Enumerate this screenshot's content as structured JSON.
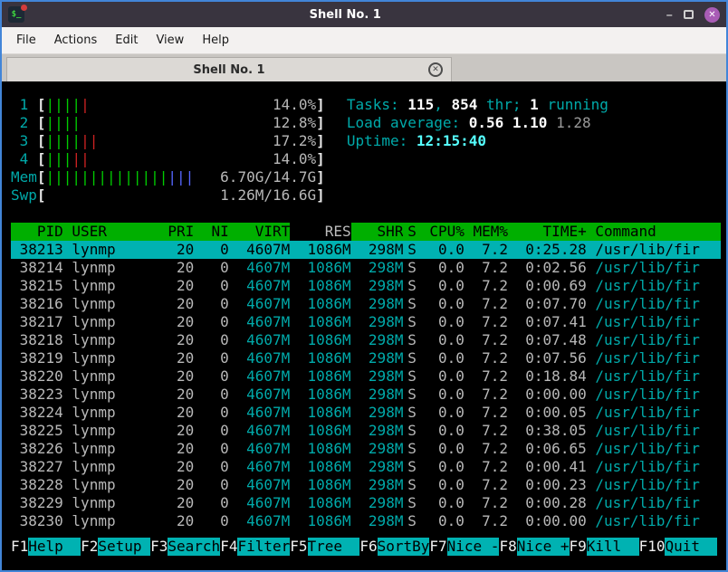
{
  "window": {
    "title": "Shell No. 1",
    "icon_glyph": "$_",
    "controls": {
      "minimize": "–",
      "close": "✕"
    }
  },
  "menubar": {
    "items": [
      "File",
      "Actions",
      "Edit",
      "View",
      "Help"
    ]
  },
  "tabbar": {
    "active_tab": "Shell No. 1",
    "close_glyph": "✕"
  },
  "colors": {
    "window_border": "#4285d8",
    "header_green": "#00af00",
    "selection_cyan": "#00b2b2",
    "accent_cyan": "#00aaaa",
    "bright_cyan": "#55ffff",
    "bar_green": "#00cc00",
    "bar_red": "#cc2222",
    "bar_blue": "#5566ff",
    "terminal_bg": "#000000",
    "terminal_fg": "#b8b8b8"
  },
  "htop": {
    "meters": [
      {
        "id": "cpu1",
        "kind": "cpu",
        "label": "1",
        "segments": [
          {
            "color": "green",
            "bars": 4
          },
          {
            "color": "red",
            "bars": 1
          }
        ],
        "value": "14.0%"
      },
      {
        "id": "cpu2",
        "kind": "cpu",
        "label": "2",
        "segments": [
          {
            "color": "green",
            "bars": 4
          }
        ],
        "value": "12.8%"
      },
      {
        "id": "cpu3",
        "kind": "cpu",
        "label": "3",
        "segments": [
          {
            "color": "green",
            "bars": 4
          },
          {
            "color": "red",
            "bars": 2
          }
        ],
        "value": "17.2%"
      },
      {
        "id": "cpu4",
        "kind": "cpu",
        "label": "4",
        "segments": [
          {
            "color": "green",
            "bars": 3
          },
          {
            "color": "red",
            "bars": 2
          }
        ],
        "value": "14.0%"
      },
      {
        "id": "mem",
        "kind": "mem",
        "label": "Mem",
        "segments": [
          {
            "color": "green",
            "bars": 14
          },
          {
            "color": "blue",
            "bars": 3
          }
        ],
        "value": "6.70G/14.7G"
      },
      {
        "id": "swp",
        "kind": "swp",
        "label": "Swp",
        "segments": [],
        "value": "1.26M/16.6G"
      }
    ],
    "sysinfo": [
      {
        "name": "tasks-line",
        "segments": [
          {
            "t": "Tasks: ",
            "c": "lbl"
          },
          {
            "t": "115",
            "c": "val"
          },
          {
            "t": ", ",
            "c": "lbl"
          },
          {
            "t": "854",
            "c": "val"
          },
          {
            "t": " thr; ",
            "c": "lbl"
          },
          {
            "t": "1",
            "c": "val"
          },
          {
            "t": " running",
            "c": "lbl"
          }
        ]
      },
      {
        "name": "load-average-line",
        "segments": [
          {
            "t": "Load average: ",
            "c": "lbl"
          },
          {
            "t": "0.56",
            "c": "val"
          },
          {
            "t": " ",
            "c": "lbl"
          },
          {
            "t": "1.10",
            "c": "val"
          },
          {
            "t": " ",
            "c": "lbl"
          },
          {
            "t": "1.28",
            "c": "dim"
          }
        ]
      },
      {
        "name": "uptime-line",
        "segments": [
          {
            "t": "Uptime: ",
            "c": "lbl"
          },
          {
            "t": "12:15:40",
            "c": "up"
          }
        ]
      }
    ],
    "table": {
      "columns": [
        {
          "key": "pid",
          "label": "PID"
        },
        {
          "key": "user",
          "label": "USER"
        },
        {
          "key": "pri",
          "label": "PRI"
        },
        {
          "key": "ni",
          "label": "NI"
        },
        {
          "key": "virt",
          "label": "VIRT"
        },
        {
          "key": "res",
          "label": "RES"
        },
        {
          "key": "shr",
          "label": "SHR"
        },
        {
          "key": "s",
          "label": "S"
        },
        {
          "key": "cpu",
          "label": "CPU%"
        },
        {
          "key": "mem",
          "label": "MEM%"
        },
        {
          "key": "time",
          "label": "TIME+"
        },
        {
          "key": "cmd",
          "label": "Command"
        }
      ],
      "sort_key": "res",
      "selected_pid": 38213,
      "rows": [
        {
          "pid": 38213,
          "user": "lynmp",
          "pri": "20",
          "ni": "0",
          "virt": "4607M",
          "res": "1086M",
          "shr": "298M",
          "s": "S",
          "cpu": "0.0",
          "mem": "7.2",
          "time": "0:25.28",
          "cmd": "/usr/lib/fir"
        },
        {
          "pid": 38214,
          "user": "lynmp",
          "pri": "20",
          "ni": "0",
          "virt": "4607M",
          "res": "1086M",
          "shr": "298M",
          "s": "S",
          "cpu": "0.0",
          "mem": "7.2",
          "time": "0:02.56",
          "cmd": "/usr/lib/fir"
        },
        {
          "pid": 38215,
          "user": "lynmp",
          "pri": "20",
          "ni": "0",
          "virt": "4607M",
          "res": "1086M",
          "shr": "298M",
          "s": "S",
          "cpu": "0.0",
          "mem": "7.2",
          "time": "0:00.69",
          "cmd": "/usr/lib/fir"
        },
        {
          "pid": 38216,
          "user": "lynmp",
          "pri": "20",
          "ni": "0",
          "virt": "4607M",
          "res": "1086M",
          "shr": "298M",
          "s": "S",
          "cpu": "0.0",
          "mem": "7.2",
          "time": "0:07.70",
          "cmd": "/usr/lib/fir"
        },
        {
          "pid": 38217,
          "user": "lynmp",
          "pri": "20",
          "ni": "0",
          "virt": "4607M",
          "res": "1086M",
          "shr": "298M",
          "s": "S",
          "cpu": "0.0",
          "mem": "7.2",
          "time": "0:07.41",
          "cmd": "/usr/lib/fir"
        },
        {
          "pid": 38218,
          "user": "lynmp",
          "pri": "20",
          "ni": "0",
          "virt": "4607M",
          "res": "1086M",
          "shr": "298M",
          "s": "S",
          "cpu": "0.0",
          "mem": "7.2",
          "time": "0:07.48",
          "cmd": "/usr/lib/fir"
        },
        {
          "pid": 38219,
          "user": "lynmp",
          "pri": "20",
          "ni": "0",
          "virt": "4607M",
          "res": "1086M",
          "shr": "298M",
          "s": "S",
          "cpu": "0.0",
          "mem": "7.2",
          "time": "0:07.56",
          "cmd": "/usr/lib/fir"
        },
        {
          "pid": 38220,
          "user": "lynmp",
          "pri": "20",
          "ni": "0",
          "virt": "4607M",
          "res": "1086M",
          "shr": "298M",
          "s": "S",
          "cpu": "0.0",
          "mem": "7.2",
          "time": "0:18.84",
          "cmd": "/usr/lib/fir"
        },
        {
          "pid": 38223,
          "user": "lynmp",
          "pri": "20",
          "ni": "0",
          "virt": "4607M",
          "res": "1086M",
          "shr": "298M",
          "s": "S",
          "cpu": "0.0",
          "mem": "7.2",
          "time": "0:00.00",
          "cmd": "/usr/lib/fir"
        },
        {
          "pid": 38224,
          "user": "lynmp",
          "pri": "20",
          "ni": "0",
          "virt": "4607M",
          "res": "1086M",
          "shr": "298M",
          "s": "S",
          "cpu": "0.0",
          "mem": "7.2",
          "time": "0:00.05",
          "cmd": "/usr/lib/fir"
        },
        {
          "pid": 38225,
          "user": "lynmp",
          "pri": "20",
          "ni": "0",
          "virt": "4607M",
          "res": "1086M",
          "shr": "298M",
          "s": "S",
          "cpu": "0.0",
          "mem": "7.2",
          "time": "0:38.05",
          "cmd": "/usr/lib/fir"
        },
        {
          "pid": 38226,
          "user": "lynmp",
          "pri": "20",
          "ni": "0",
          "virt": "4607M",
          "res": "1086M",
          "shr": "298M",
          "s": "S",
          "cpu": "0.0",
          "mem": "7.2",
          "time": "0:06.65",
          "cmd": "/usr/lib/fir"
        },
        {
          "pid": 38227,
          "user": "lynmp",
          "pri": "20",
          "ni": "0",
          "virt": "4607M",
          "res": "1086M",
          "shr": "298M",
          "s": "S",
          "cpu": "0.0",
          "mem": "7.2",
          "time": "0:00.41",
          "cmd": "/usr/lib/fir"
        },
        {
          "pid": 38228,
          "user": "lynmp",
          "pri": "20",
          "ni": "0",
          "virt": "4607M",
          "res": "1086M",
          "shr": "298M",
          "s": "S",
          "cpu": "0.0",
          "mem": "7.2",
          "time": "0:00.23",
          "cmd": "/usr/lib/fir"
        },
        {
          "pid": 38229,
          "user": "lynmp",
          "pri": "20",
          "ni": "0",
          "virt": "4607M",
          "res": "1086M",
          "shr": "298M",
          "s": "S",
          "cpu": "0.0",
          "mem": "7.2",
          "time": "0:00.28",
          "cmd": "/usr/lib/fir"
        },
        {
          "pid": 38230,
          "user": "lynmp",
          "pri": "20",
          "ni": "0",
          "virt": "4607M",
          "res": "1086M",
          "shr": "298M",
          "s": "S",
          "cpu": "0.0",
          "mem": "7.2",
          "time": "0:00.00",
          "cmd": "/usr/lib/fir"
        }
      ]
    },
    "fkeys": [
      {
        "key": "F1",
        "label": "Help"
      },
      {
        "key": "F2",
        "label": "Setup"
      },
      {
        "key": "F3",
        "label": "Search"
      },
      {
        "key": "F4",
        "label": "Filter"
      },
      {
        "key": "F5",
        "label": "Tree"
      },
      {
        "key": "F6",
        "label": "SortBy"
      },
      {
        "key": "F7",
        "label": "Nice -"
      },
      {
        "key": "F8",
        "label": "Nice +"
      },
      {
        "key": "F9",
        "label": "Kill"
      },
      {
        "key": "F10",
        "label": "Quit"
      }
    ]
  }
}
